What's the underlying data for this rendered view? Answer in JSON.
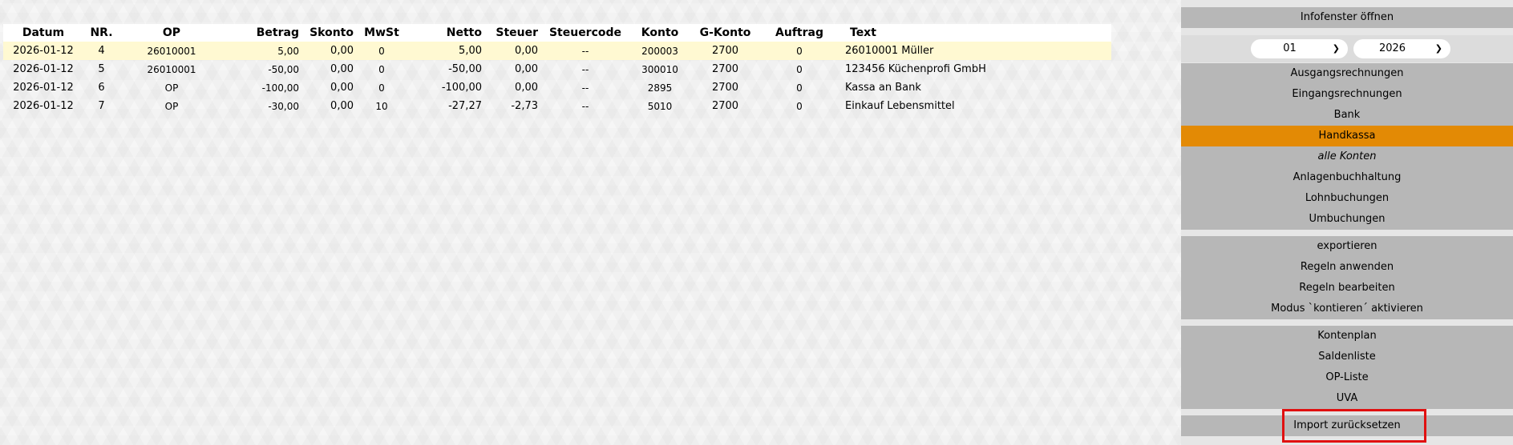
{
  "table": {
    "headers": [
      "Datum",
      "NR.",
      "OP",
      "Betrag",
      "Skonto",
      "MwSt",
      "Netto",
      "Steuer",
      "Steuercode",
      "Konto",
      "G-Konto",
      "Auftrag",
      "Text"
    ],
    "rows": [
      [
        "2026-01-12",
        "4",
        "26010001",
        "5,00",
        "0,00",
        "0",
        "5,00",
        "0,00",
        "--",
        "200003",
        "2700",
        "0",
        "26010001 Müller"
      ],
      [
        "2026-01-12",
        "5",
        "26010001",
        "-50,00",
        "0,00",
        "0",
        "-50,00",
        "0,00",
        "--",
        "300010",
        "2700",
        "0",
        "123456 Küchenprofi GmbH"
      ],
      [
        "2026-01-12",
        "6",
        "OP",
        "-100,00",
        "0,00",
        "0",
        "-100,00",
        "0,00",
        "--",
        "2895",
        "2700",
        "0",
        "Kassa an Bank"
      ],
      [
        "2026-01-12",
        "7",
        "OP",
        "-30,00",
        "0,00",
        "10",
        "-27,27",
        "-2,73",
        "--",
        "5010",
        "2700",
        "0",
        "Einkauf Lebensmittel"
      ]
    ]
  },
  "sidebar": {
    "infofenster": "Infofenster öffnen",
    "month_select": "01",
    "year_select": "2026",
    "group1": [
      "Ausgangsrechnungen",
      "Eingangsrechnungen",
      "Bank",
      "Handkassa",
      "alle Konten",
      "Anlagenbuchhaltung",
      "Lohnbuchungen",
      "Umbuchungen"
    ],
    "group2": [
      "exportieren",
      "Regeln anwenden",
      "Regeln bearbeiten",
      "Modus `kontieren´ aktivieren"
    ],
    "group3": [
      "Kontenplan",
      "Saldenliste",
      "OP-Liste",
      "UVA"
    ],
    "import_reset": "Import zurücksetzen",
    "active_item": "Handkassa",
    "active_color": "#e38a05",
    "highlight_color": "#e01010"
  }
}
